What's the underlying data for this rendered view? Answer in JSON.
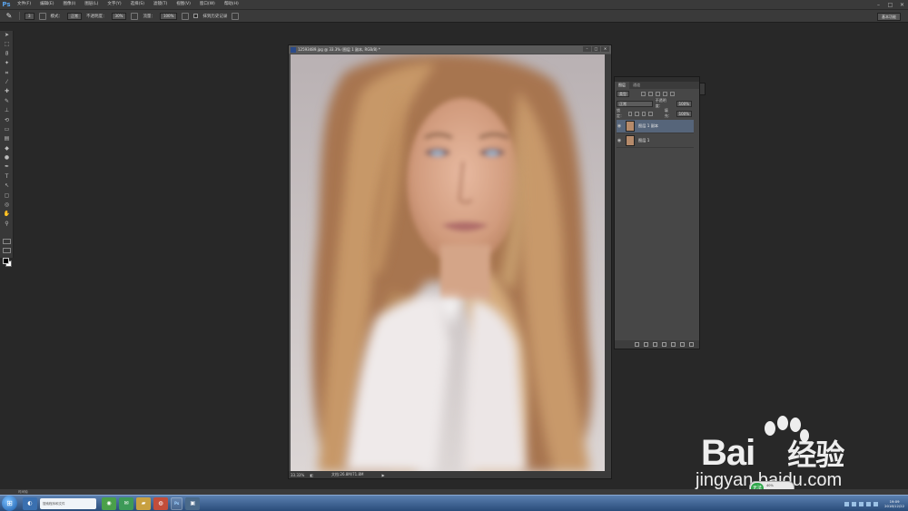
{
  "menu": {
    "logo": "Ps",
    "items": [
      "文件(F)",
      "编辑(E)",
      "图像(I)",
      "图层(L)",
      "文字(Y)",
      "选择(S)",
      "滤镜(T)",
      "视图(V)",
      "窗口(W)",
      "帮助(H)"
    ]
  },
  "options": {
    "brush_size": "3",
    "mode_label": "模式：",
    "mode_value": "正常",
    "opacity_label": "不透明度：",
    "opacity_value": "30%",
    "flow_label": "流量：",
    "flow_value": "100%",
    "history_label": "抹到历史记录",
    "workspace": "基本功能"
  },
  "document": {
    "title": "12593489.jpg @ 33.3% (图层 1 副本, RGB/8) *",
    "zoom": "33.33%",
    "doc_size": "文档:26.8M/71.8M"
  },
  "layers_panel": {
    "tabs": [
      "图层",
      "通道"
    ],
    "filter_kind": "类型",
    "blend_mode": "正常",
    "opacity_label": "不透明度：",
    "opacity_value": "100%",
    "lock_label": "锁定：",
    "fill_label": "填充：",
    "fill_value": "100%",
    "layers": [
      {
        "name": "图层 1 副本",
        "selected": true
      },
      {
        "name": "图层 1",
        "selected": false
      }
    ]
  },
  "watermark": {
    "brand": "Bai",
    "brand_cn": "经验",
    "url": "jingyan.baidu.com"
  },
  "taskbar": {
    "search_placeholder": "搜索程序和文件",
    "strip_text": "时间轴",
    "ps_label": "Ps",
    "clock_time": "19:09",
    "clock_date": "2018/12/22"
  },
  "float_widget": {
    "badge": "无法",
    "text": "40%"
  }
}
